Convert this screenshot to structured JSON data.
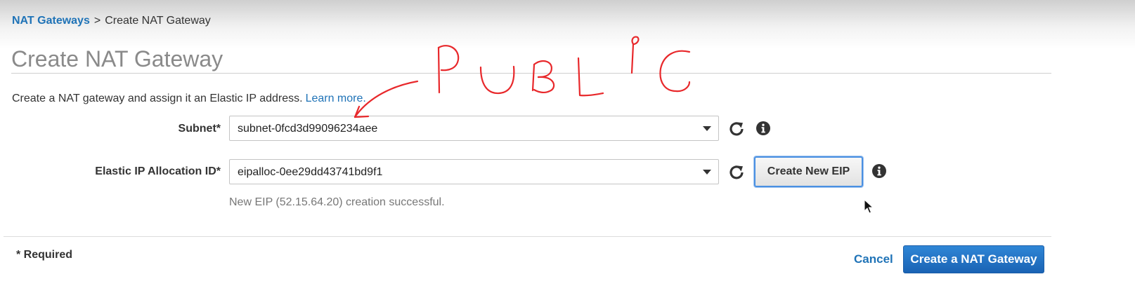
{
  "breadcrumb": {
    "parent": "NAT Gateways",
    "separator": ">",
    "current": "Create NAT Gateway"
  },
  "page": {
    "title": "Create NAT Gateway",
    "description": "Create a NAT gateway and assign it an Elastic IP address.",
    "learn_more": "Learn more."
  },
  "form": {
    "subnet": {
      "label": "Subnet*",
      "value": "subnet-0fcd3d99096234aee",
      "refresh_icon": "refresh-icon",
      "info_icon": "info-icon"
    },
    "eip": {
      "label": "Elastic IP Allocation ID*",
      "value": "eipalloc-0ee29dd43741bd9f1",
      "refresh_icon": "refresh-icon",
      "create_button": "Create New EIP",
      "info_icon": "info-icon"
    },
    "success_message": "New EIP (52.15.64.20) creation successful."
  },
  "footer": {
    "required_note": "* Required",
    "cancel": "Cancel",
    "submit": "Create a NAT Gateway"
  },
  "annotation": {
    "handwritten_text": "PUBLIC",
    "color": "#e8282b"
  },
  "colors": {
    "link": "#1f73b7",
    "primary_button": "#1a63b4",
    "title": "#8a8a8a",
    "annotation": "#e8282b"
  }
}
